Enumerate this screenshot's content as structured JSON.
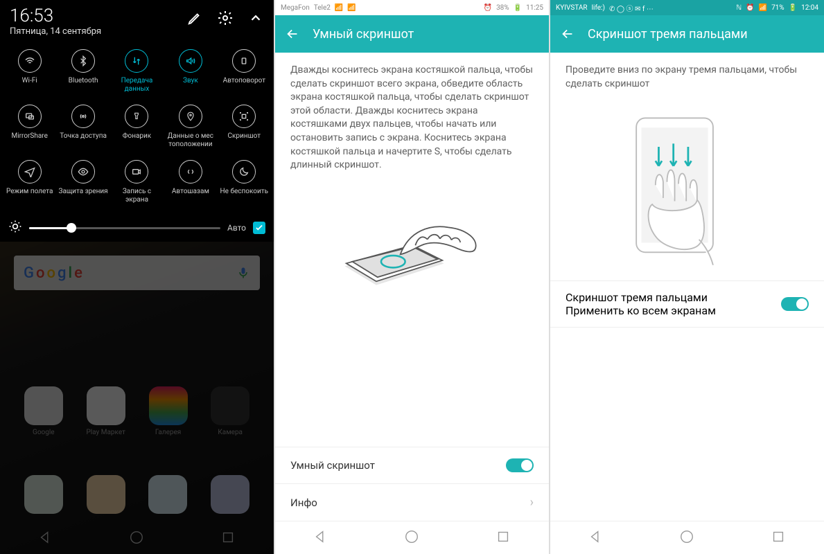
{
  "screen1": {
    "time": "16:53",
    "date": "Пятница, 14 сентября",
    "tiles": [
      {
        "label": "Wi-Fi",
        "active": false
      },
      {
        "label": "Bluetooth",
        "active": false
      },
      {
        "label": "Передача данных",
        "active": true
      },
      {
        "label": "Звук",
        "active": true
      },
      {
        "label": "Автоповорот",
        "active": false
      },
      {
        "label": "MirrorShare",
        "active": false
      },
      {
        "label": "Точка доступа",
        "active": false
      },
      {
        "label": "Фонарик",
        "active": false
      },
      {
        "label": "Данные о мес тоположении",
        "active": false
      },
      {
        "label": "Скриншот",
        "active": false
      },
      {
        "label": "Режим полета",
        "active": false
      },
      {
        "label": "Защита зрения",
        "active": false
      },
      {
        "label": "Запись с экрана",
        "active": false
      },
      {
        "label": "Автошазам",
        "active": false
      },
      {
        "label": "Не беспокоить",
        "active": false
      }
    ],
    "brightness_auto_label": "Авто",
    "home_apps": [
      "Google",
      "Play Маркет",
      "Галерея",
      "Камера"
    ]
  },
  "screen2": {
    "status": {
      "carrier1": "MegaFon",
      "carrier2": "Tele2",
      "battery": "38%",
      "time": "11:25"
    },
    "title": "Умный скриншот",
    "description": "Дважды коснитесь экрана костяшкой пальца, чтобы сделать скриншот всего экрана, обведите область экрана костяшкой пальца, чтобы сделать скриншот этой области. Дважды коснитесь экрана костяшками двух пальцев, чтобы начать или остановить запись с экрана. Коснитесь экрана костяшкой пальца и начертите S, чтобы сделать длинный скриншот.",
    "row1": "Умный скриншот",
    "row2": "Инфо"
  },
  "screen3": {
    "status": {
      "carrier1": "KYIVSTAR",
      "carrier2": "life:)",
      "battery": "71%",
      "time": "12:04"
    },
    "title": "Скриншот тремя пальцами",
    "description": "Проведите вниз по экрану тремя пальцами, чтобы сделать скриншот",
    "setting_title": "Скриншот тремя пальцами",
    "setting_sub": "Применить ко всем экранам"
  }
}
